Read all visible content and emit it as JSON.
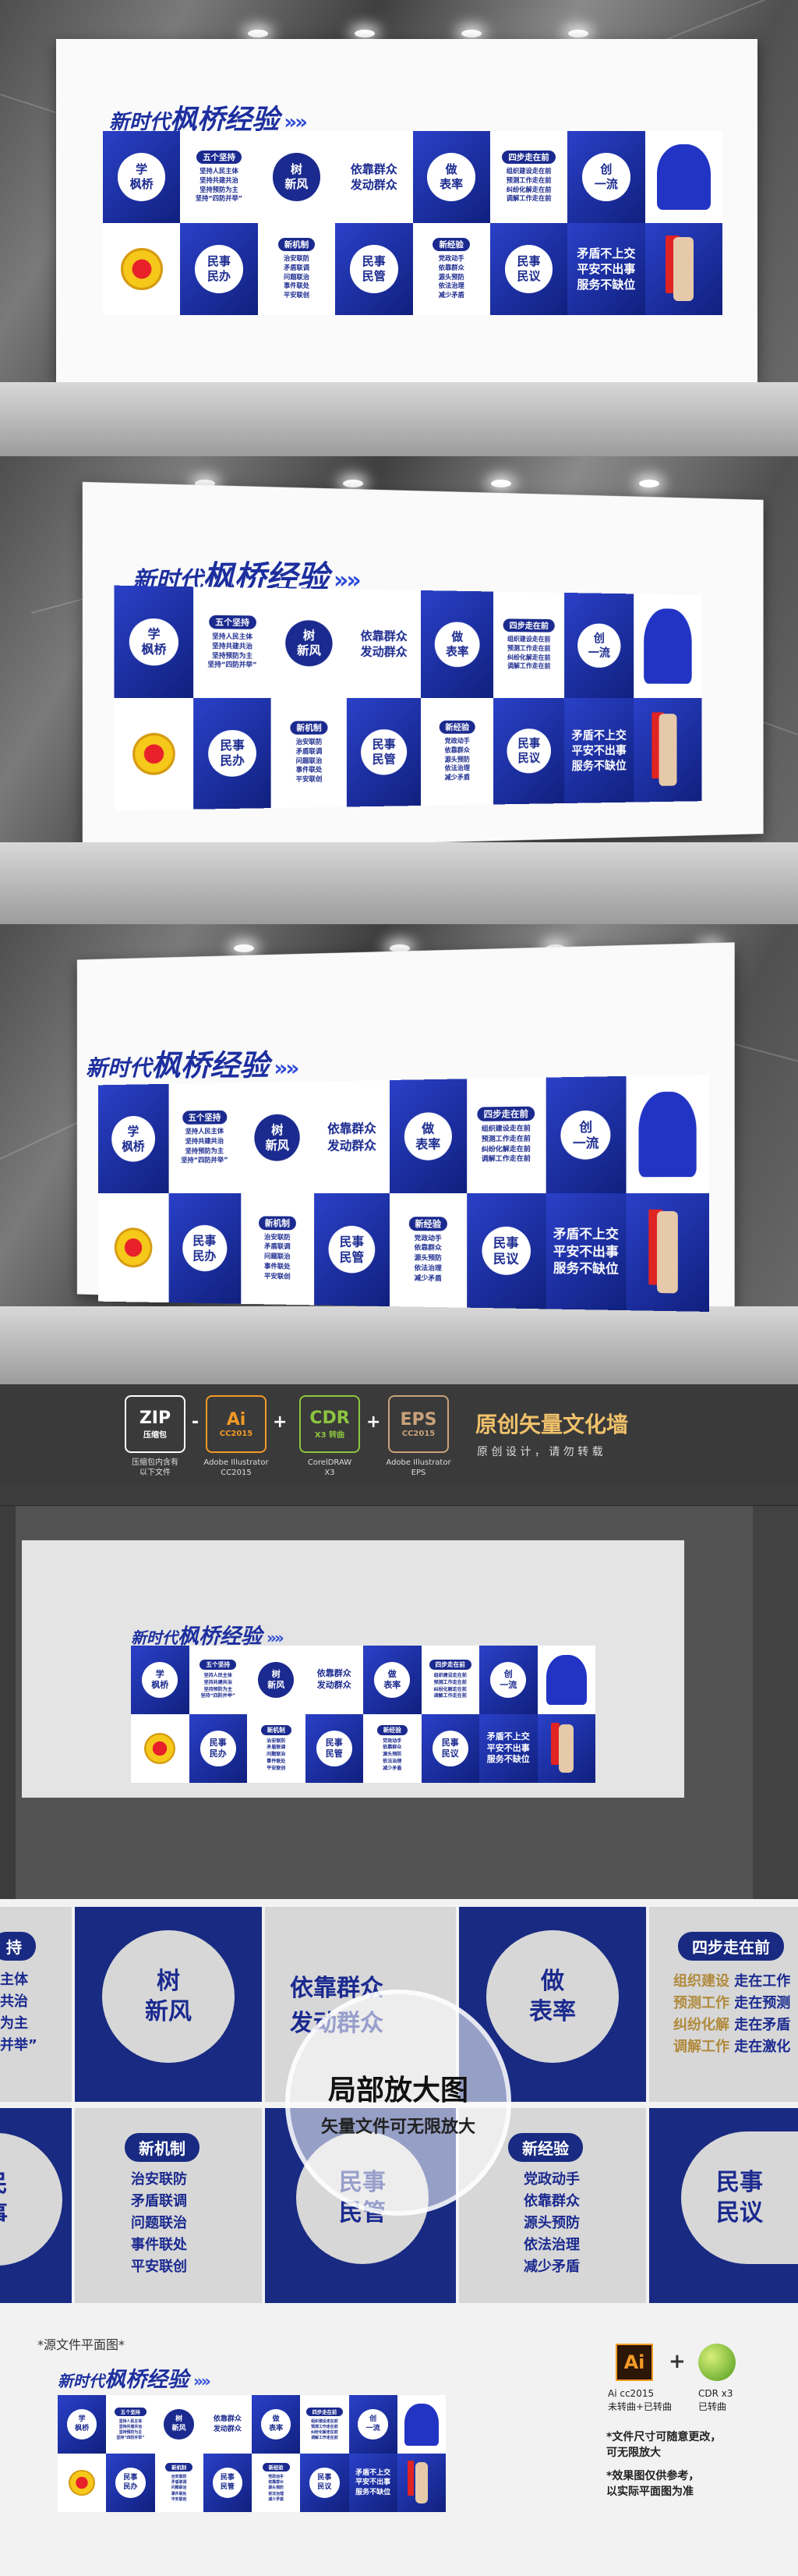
{
  "wall": {
    "title_prefix": "新时代",
    "title_main": "枫桥经验",
    "arrows": "»»",
    "row1": [
      {
        "kind": "circle",
        "bg": "b",
        "text": "学\n枫桥"
      },
      {
        "kind": "list",
        "bg": "w",
        "pill": "五个坚持",
        "lines": "坚持人民主体\n坚持共建共治\n坚持预防为主\n坚持“四防并举”"
      },
      {
        "kind": "circle",
        "bg": "w",
        "text": "树\n新风"
      },
      {
        "kind": "text",
        "bg": "w",
        "text": "依靠群众\n发动群众"
      },
      {
        "kind": "circle",
        "bg": "b",
        "text": "做\n表率"
      },
      {
        "kind": "list",
        "bg": "w",
        "pill": "四步走在前",
        "lines": "组织建设走在前\n预测工作走在前\n纠纷化解走在前\n调解工作走在前"
      },
      {
        "kind": "circle",
        "bg": "b",
        "text": "创\n一流"
      },
      {
        "kind": "silhouette",
        "bg": "w"
      }
    ],
    "row2": [
      {
        "kind": "emblem",
        "bg": "w"
      },
      {
        "kind": "circle",
        "bg": "b",
        "text": "民事\n民办"
      },
      {
        "kind": "list",
        "bg": "w",
        "pill": "新机制",
        "lines": "治安联防\n矛盾联调\n问题联治\n事件联处\n平安联创"
      },
      {
        "kind": "circle",
        "bg": "b",
        "text": "民事\n民管"
      },
      {
        "kind": "list",
        "bg": "w",
        "pill": "新经验",
        "lines": "党政动手\n依靠群众\n源头预防\n依法治理\n减少矛盾"
      },
      {
        "kind": "circle",
        "bg": "b",
        "text": "民事\n民议"
      },
      {
        "kind": "text",
        "bg": "b",
        "text": "矛盾不上交\n平安不出事\n服务不缺位"
      },
      {
        "kind": "torch",
        "bg": "b"
      }
    ]
  },
  "banner": {
    "formats": [
      {
        "t": "ZIP",
        "s": "压缩包",
        "label": "压缩包内含有\n以下文件",
        "color": "#ffffff"
      },
      {
        "t": "Ai",
        "s": "CC2015",
        "label": "Adobe Illustrator\nCC2015",
        "color": "#f29a25"
      },
      {
        "t": "CDR",
        "s": "X3 转曲",
        "label": "CorelDRAW\nX3",
        "color": "#8dc63f"
      },
      {
        "t": "EPS",
        "s": "CC2015",
        "label": "Adobe Illustrator\nEPS",
        "color": "#c9a27a"
      }
    ],
    "separators": [
      "-",
      "+",
      "+"
    ],
    "headline": "原创矢量文化墙",
    "subline": "原 创 设 计 ， 请 勿 转 载"
  },
  "zoom": {
    "left_edge_pill": "持",
    "left_edge_text": "主体\n共治\n为主\n并举”",
    "circle_1": "树\n新风",
    "mid_text": "依靠群众\n发动群众",
    "circle_2": "做\n表率",
    "pill_1": "四步走在前",
    "list_1": [
      {
        "a": "组织建设",
        "b": "走在工作"
      },
      {
        "a": "预测工作",
        "b": "走在预测"
      },
      {
        "a": "纠纷化解",
        "b": "走在矛盾"
      },
      {
        "a": "调解工作",
        "b": "走在激化"
      }
    ],
    "pill_2": "新机制",
    "list_2": "治安联防\n矛盾联调\n问题联治\n事件联处\n平安联创",
    "circle_3": "民事\n民管",
    "pill_3": "新经验",
    "list_3": "党政动手\n依靠群众\n源头预防\n依法治理\n减少矛盾",
    "circle_4": "民事\n民议",
    "left_bottom": "民\n事",
    "lens_title": "局部放大图",
    "lens_sub": "矢量文件可无限放大"
  },
  "bottom": {
    "caption": "*源文件平面图*",
    "ai_label": "Ai cc2015\n未转曲+已转曲",
    "cdr_label": "CDR x3\n已转曲",
    "plus": "+",
    "note_1": "*文件尺寸可随意更改，\n可无限放大",
    "note_2": "*效果图仅供参考，\n以实际平面图为准"
  },
  "colors": {
    "brand_blue": "#1b2a8f",
    "accent_blue": "#2a40c8",
    "gold": "#b08a3c"
  }
}
